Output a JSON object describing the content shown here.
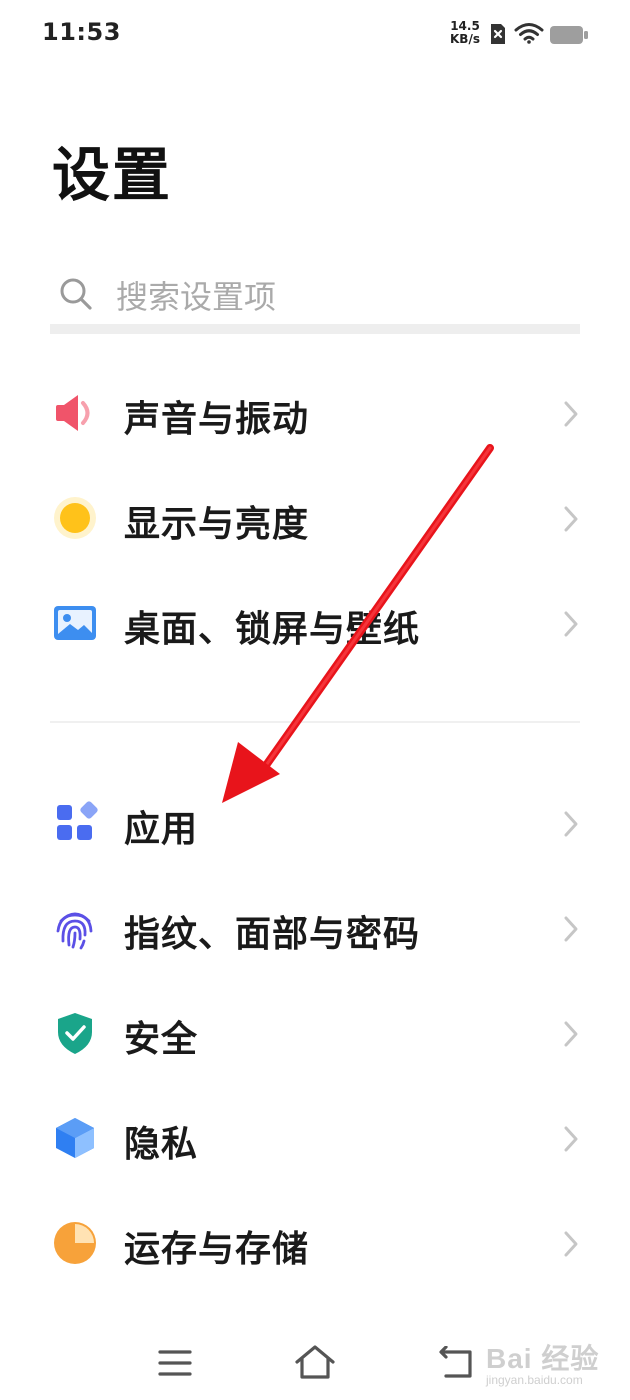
{
  "status_bar": {
    "time": "11:53",
    "net_speed_value": "14.5",
    "net_speed_unit": "KB/s",
    "icons": [
      "sim-blocked-icon",
      "wifi-icon",
      "battery-icon"
    ]
  },
  "page": {
    "title": "设置"
  },
  "search": {
    "placeholder": "搜索设置项",
    "value": ""
  },
  "groups": [
    {
      "items": [
        {
          "label": "声音与振动",
          "icon": "speaker-icon",
          "color": "#f0546a"
        },
        {
          "label": "显示与亮度",
          "icon": "sun-icon",
          "color": "#ffc21a"
        },
        {
          "label": "桌面、锁屏与壁纸",
          "icon": "wallpaper-icon",
          "color": "#3d8ef0"
        }
      ]
    },
    {
      "items": [
        {
          "label": "应用",
          "icon": "apps-icon",
          "color": "#4a6cf0"
        },
        {
          "label": "指纹、面部与密码",
          "icon": "fingerprint-icon",
          "color": "#5b50e6"
        },
        {
          "label": "安全",
          "icon": "shield-icon",
          "color": "#1aa58a"
        },
        {
          "label": "隐私",
          "icon": "privacy-cube-icon",
          "color": "#2f7ff2"
        },
        {
          "label": "运存与存储",
          "icon": "storage-pie-icon",
          "color": "#f7a23a"
        }
      ]
    }
  ],
  "nav_bar": {
    "icons": [
      "menu-icon",
      "home-icon",
      "back-icon"
    ]
  },
  "watermark": {
    "brand": "Bai 经验",
    "sub": "jingyan.baidu.com"
  },
  "colors": {
    "annotation_arrow": "#e8141b",
    "chevron": "#c6c6c6",
    "placeholder": "#aaaaaa"
  }
}
